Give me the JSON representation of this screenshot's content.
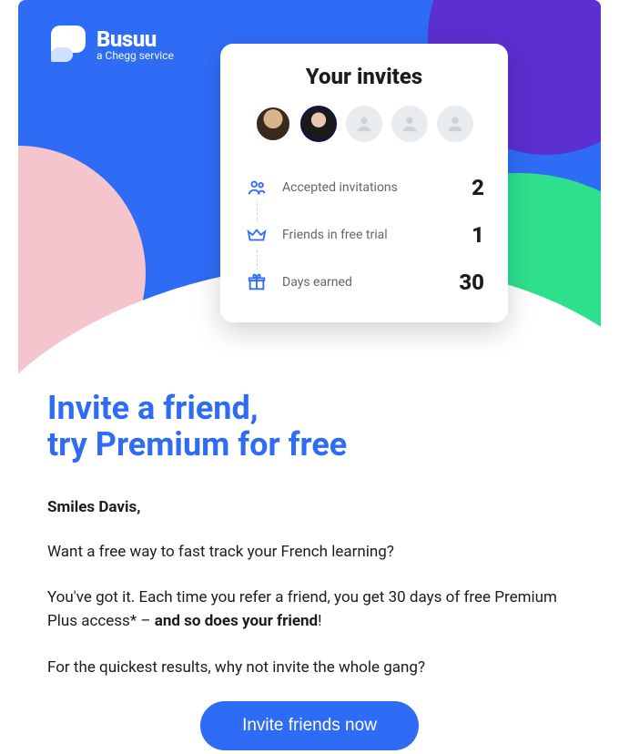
{
  "logo": {
    "brand": "Busuu",
    "tagline": "a Chegg service"
  },
  "card": {
    "title": "Your invites",
    "avatars": [
      {
        "filled": true
      },
      {
        "filled": true
      },
      {
        "filled": false
      },
      {
        "filled": false
      },
      {
        "filled": false
      }
    ],
    "stats": [
      {
        "icon": "people-icon",
        "label": "Accepted invitations",
        "value": "2"
      },
      {
        "icon": "crown-icon",
        "label": "Friends in free trial",
        "value": "1"
      },
      {
        "icon": "gift-icon",
        "label": "Days earned",
        "value": "30"
      }
    ]
  },
  "headline": "Invite a friend,\ntry Premium for free",
  "greeting": "Smiles Davis,",
  "paragraphs": {
    "p1": "Want a free way to fast track your French learning?",
    "p2_pre": "You've got it. Each time you refer a friend, you get 30 days of free Premium Plus access* – ",
    "p2_bold": "and so does your friend",
    "p2_post": "!",
    "p3": "For the quickest results, why not invite the whole gang?"
  },
  "cta": "Invite friends now"
}
